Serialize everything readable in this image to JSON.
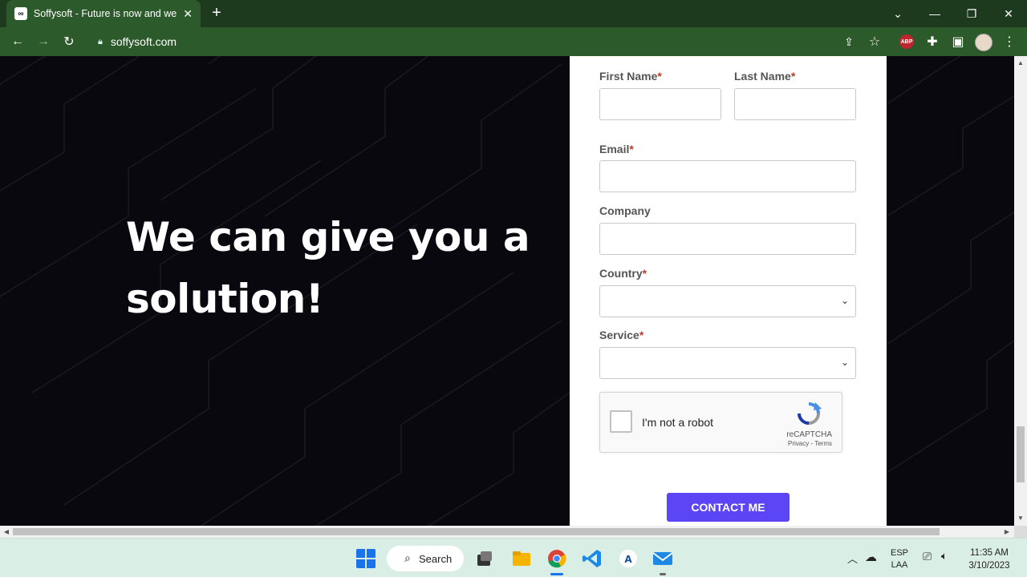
{
  "browser": {
    "tab_title": "Soffysoft - Future is now and we",
    "tab_favicon": "∞",
    "new_tab_label": "+",
    "url": "soffysoft.com",
    "abp_label": "ABP"
  },
  "page": {
    "headline": "We can give you a solution!"
  },
  "form": {
    "first_name_label": "First Name",
    "last_name_label": "Last Name",
    "email_label": "Email",
    "company_label": "Company",
    "country_label": "Country",
    "service_label": "Service",
    "required_mark": "*",
    "captcha_label": "I'm not a robot",
    "captcha_brand": "reCAPTCHA",
    "captcha_links": "Privacy - Terms",
    "submit_label": "CONTACT ME"
  },
  "taskbar": {
    "search_label": "Search",
    "lang_top": "ESP",
    "lang_bottom": "LAA",
    "time": "11:35 AM",
    "date": "3/10/2023"
  },
  "colors": {
    "tab_strip": "#1e3a1e",
    "toolbar": "#2d5a2a",
    "page_bg": "#08080e",
    "accent": "#5b45f5",
    "required": "#c0392b"
  }
}
